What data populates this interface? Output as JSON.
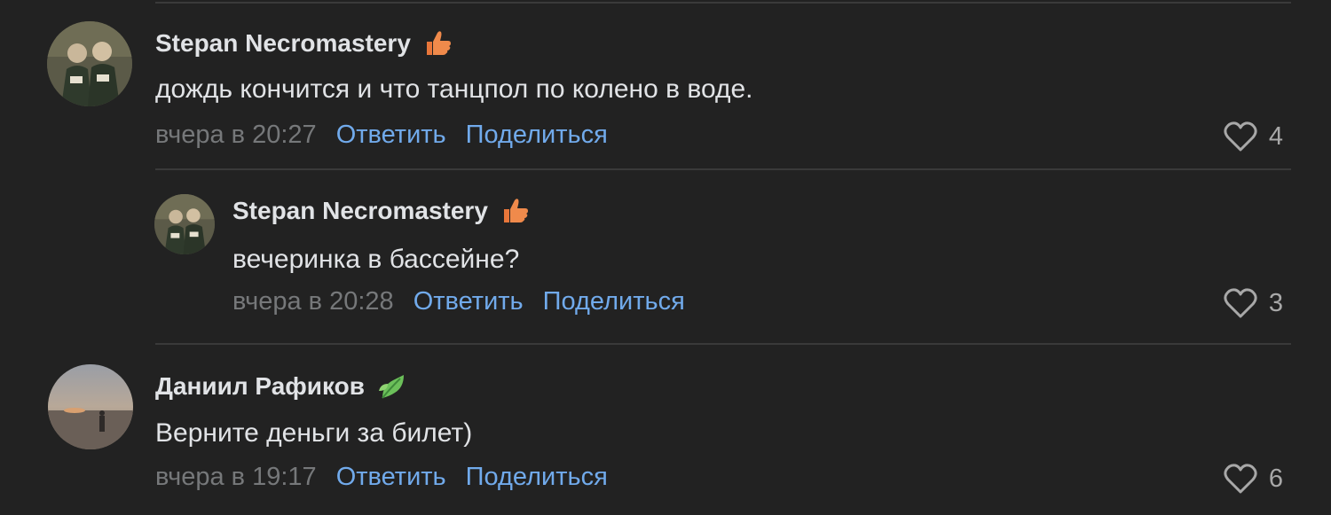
{
  "comments": [
    {
      "author": "Stepan Necromastery",
      "badge": "thumbs-up-icon",
      "text": "дождь кончится и что танцпол по колено в воде.",
      "time": "вчера в 20:27",
      "reply_label": "Ответить",
      "share_label": "Поделиться",
      "likes": "4"
    },
    {
      "author": "Stepan Necromastery",
      "badge": "thumbs-up-icon",
      "text": "вечеринка в бассейне?",
      "time": "вчера в 20:28",
      "reply_label": "Ответить",
      "share_label": "Поделиться",
      "likes": "3"
    },
    {
      "author": "Даниил Рафиков",
      "badge": "leaves-icon",
      "text": "Верните деньги за билет)",
      "time": "вчера в 19:17",
      "reply_label": "Ответить",
      "share_label": "Поделиться",
      "likes": "6"
    }
  ],
  "colors": {
    "background": "#222222",
    "text": "#e1e3e6",
    "muted": "#76787a",
    "link": "#71aaeb",
    "badge_orange": "#e8763a",
    "badge_green": "#6cc05a"
  }
}
